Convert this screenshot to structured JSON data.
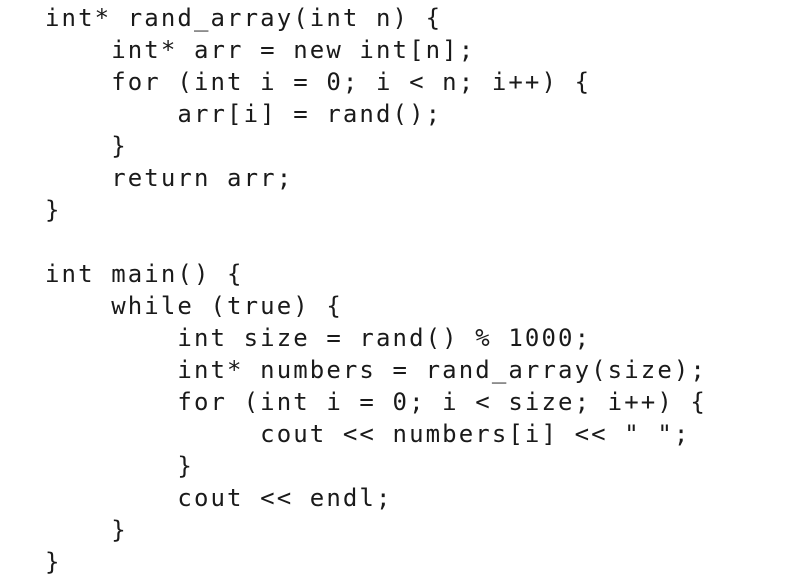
{
  "document": {
    "language": "C++",
    "lines": [
      "int* rand_array(int n) {",
      "    int* arr = new int[n];",
      "    for (int i = 0; i < n; i++) {",
      "        arr[i] = rand();",
      "    }",
      "    return arr;",
      "}",
      "",
      "int main() {",
      "    while (true) {",
      "        int size = rand() % 1000;",
      "        int* numbers = rand_array(size);",
      "        for (int i = 0; i < size; i++) {",
      "             cout << numbers[i] << \" \";",
      "        }",
      "        cout << endl;",
      "    }",
      "}"
    ]
  }
}
